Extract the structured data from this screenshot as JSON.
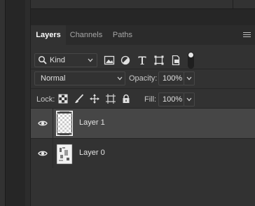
{
  "tabs": [
    {
      "label": "Layers",
      "active": true
    },
    {
      "label": "Channels",
      "active": false
    },
    {
      "label": "Paths",
      "active": false
    }
  ],
  "filter": {
    "kind_label": "Kind",
    "icons": [
      "image-filter-icon",
      "adjustment-filter-icon",
      "type-filter-icon",
      "shape-filter-icon",
      "smart-object-filter-icon"
    ],
    "toggle_on": true
  },
  "blend": {
    "mode": "Normal",
    "opacity_label": "Opacity:",
    "opacity_value": "100%"
  },
  "lock": {
    "label": "Lock:",
    "icons": [
      "lock-transparent-pixels-icon",
      "lock-image-pixels-icon",
      "lock-position-icon",
      "lock-artboard-icon",
      "lock-all-icon"
    ],
    "fill_label": "Fill:",
    "fill_value": "100%"
  },
  "layers": [
    {
      "name": "Layer 1",
      "selected": true,
      "visible": true
    },
    {
      "name": "Layer 0",
      "selected": false,
      "visible": true
    }
  ],
  "colors": {
    "panel_bg": "#323232",
    "selected_row": "#464646",
    "text": "#e2e2e2"
  }
}
